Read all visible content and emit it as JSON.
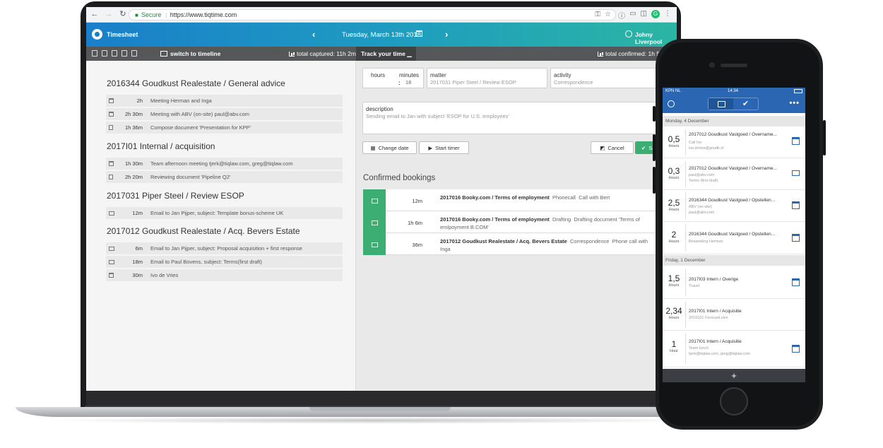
{
  "browser": {
    "secure_label": "Secure",
    "url": "https://www.tiqtime.com"
  },
  "app": {
    "name": "Timesheet",
    "date": "Tuesday, March 13th 2018",
    "user": "Johny Liverpool"
  },
  "toolbar": {
    "switch_label": "switch to timeline",
    "total_captured": "total captured: 11h 2m",
    "track_label": "Track your time",
    "total_confirmed": "total confirmed: 1h 54m"
  },
  "groups": [
    {
      "title": "2016344 Goudkust Realestate / General advice",
      "entries": [
        {
          "icon": "calendar-icon",
          "duration": "2h",
          "description": "Meeting Herman and Inga"
        },
        {
          "icon": "calendar-icon",
          "duration": "2h 30m",
          "description": "Meeting with ABV (on-site) paul@abv.com"
        },
        {
          "icon": "document-icon",
          "duration": "1h 36m",
          "description": "Compose document 'Presentation for KPP'"
        }
      ]
    },
    {
      "title": "2017I01 Internal / acquisition",
      "entries": [
        {
          "icon": "calendar-icon",
          "duration": "1h 30m",
          "description": "Team afternoon meeting tjerk@tiqlaw.com, greg@tiqlaw.com"
        },
        {
          "icon": "document-icon",
          "duration": "2h 20m",
          "description": "Reviewing document 'Pipeline Q2'"
        }
      ]
    },
    {
      "title": "2017031 Piper Steel / Review ESOP",
      "entries": [
        {
          "icon": "mail-icon",
          "duration": "12m",
          "description": "Email to Jan Pijper, subject: Template bonus-scheme UK"
        }
      ]
    },
    {
      "title": "2017012 Goudkust Realestate / Acq. Bevers Estate",
      "entries": [
        {
          "icon": "mail-icon",
          "duration": "6m",
          "description": "Email to Jan Pijper, subject: Proposal acquisition + first response"
        },
        {
          "icon": "mail-icon",
          "duration": "18m",
          "description": "Email to Paul Bovens, subject: Terms(first draft)"
        },
        {
          "icon": "phone-icon",
          "duration": "30m",
          "description": "Ivo de Vries"
        }
      ]
    }
  ],
  "form": {
    "hours_label": "hours",
    "minutes_label": "minutes",
    "minutes_value": "18",
    "separator": ":",
    "matter_label": "matter",
    "matter_value": "2017031 Piper Steel / Review ESOP",
    "activity_label": "activity",
    "activity_value": "Correspondence",
    "description_label": "description",
    "description_value": "Sending email to Jan with subject 'ESOP for U.S. employees'",
    "change_date_label": "Change date",
    "start_timer_label": "Start timer",
    "cancel_label": "Cancel",
    "save_label": "Sa"
  },
  "confirmed": {
    "title": "Confirmed bookings",
    "rows": [
      {
        "duration": "12m",
        "matter": "2017016 Booky.com / Terms of employment",
        "activity": "Phonecall",
        "description": "Call with Bert"
      },
      {
        "duration": "1h 6m",
        "matter": "2017016 Booky.com / Terms of employment",
        "activity": "Drafting",
        "description": "Drafting document 'Terms of emlpoyment B.COM'"
      },
      {
        "duration": "36m",
        "matter": "2017012 Goudkust Realestate / Acq. Bevers Estate",
        "activity": "Correspondence",
        "description": "Phone call with Inga"
      }
    ]
  },
  "phone": {
    "carrier": "KPN NL",
    "time": "14:34",
    "more": "•••",
    "add_label": "+",
    "sections": [
      {
        "label": "Monday, 4 December",
        "items": [
          {
            "hours": "0,5",
            "unit": "Hours",
            "title": "2017012 Goudkust Vastgoed / Overname...",
            "sub1": "Call Ivo",
            "sub2": "ivo.dvries@goudk.nl",
            "icon": "calendar-icon"
          },
          {
            "hours": "0,3",
            "unit": "Hours",
            "title": "2017012 Goudkust Vastgoed / Overname...",
            "sub1": "paul@abv.com",
            "sub2": "Terms (first draft)",
            "icon": "mail-icon"
          },
          {
            "hours": "2,5",
            "unit": "Hours",
            "title": "2016344 Goudkust Vastgoed / Opstellen...",
            "sub1": "ABV (on-site)",
            "sub2": "paul@abv.com",
            "icon": "calendar-icon"
          },
          {
            "hours": "2",
            "unit": "Hours",
            "title": "2016344 Goudkust Vastgoed / Opstellen...",
            "sub1": "Bespreking Herman",
            "sub2": "",
            "icon": "calendar-icon"
          }
        ]
      },
      {
        "label": "Friday, 1 December",
        "items": [
          {
            "hours": "1,5",
            "unit": "Hours",
            "title": "2017I03 Intern / Overige",
            "sub1": "Travel",
            "sub2": "",
            "icon": "calendar-icon"
          },
          {
            "hours": "2,34",
            "unit": "Hours",
            "title": "2017I01 Intern / Acquisitie",
            "sub1": "2015101 Forecast.xlsx",
            "sub2": "",
            "icon": ""
          },
          {
            "hours": "1",
            "unit": "Hour",
            "title": "2017I01 Intern / Acquisitie",
            "sub1": "Team lunch",
            "sub2": "tjerk@tiqlaw.com, greg@tiqlaw.com",
            "icon": "calendar-icon"
          }
        ]
      }
    ]
  },
  "colors": {
    "header_start": "#1a7fc9",
    "header_end": "#2bb5a3",
    "accent_green": "#3dae73",
    "phone_blue": "#2a66b1"
  }
}
